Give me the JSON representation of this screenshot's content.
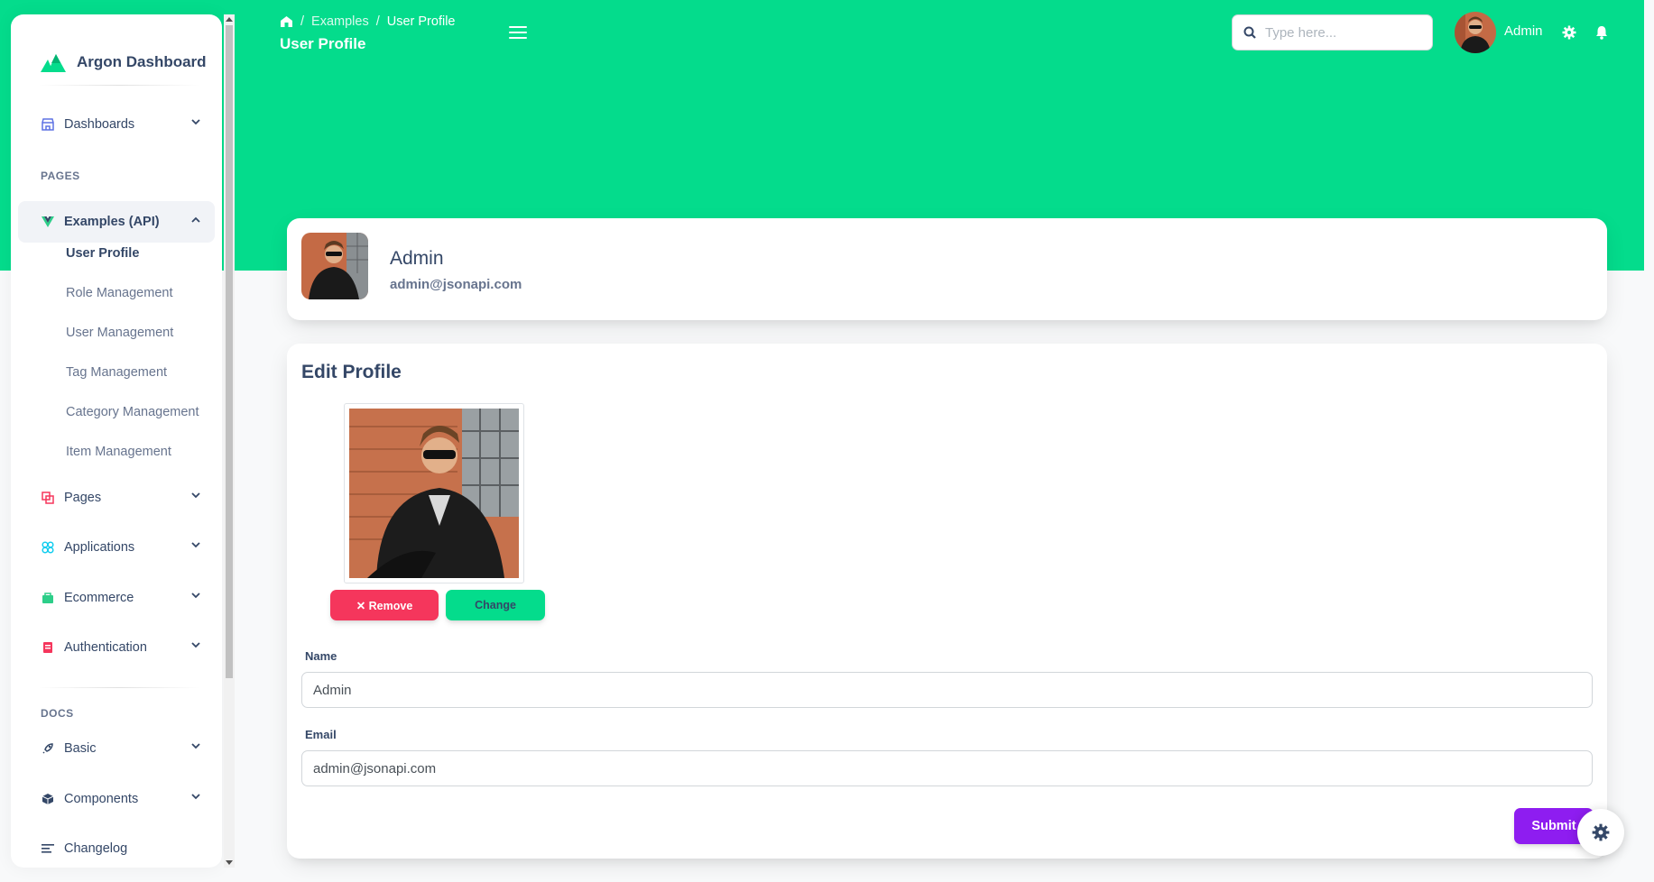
{
  "brand": {
    "name": "Argon Dashboard"
  },
  "sidebar": {
    "dashboards": "Dashboards",
    "pages_section": "PAGES",
    "examples": "Examples (API)",
    "sub_items": [
      "User Profile",
      "Role Management",
      "User Management",
      "Tag Management",
      "Category Management",
      "Item Management"
    ],
    "pages": "Pages",
    "applications": "Applications",
    "ecommerce": "Ecommerce",
    "authentication": "Authentication",
    "docs_section": "DOCS",
    "basic": "Basic",
    "components": "Components",
    "changelog": "Changelog"
  },
  "header": {
    "breadcrumb_examples": "Examples",
    "breadcrumb_current": "User Profile",
    "breadcrumb_sep": "/",
    "title": "User Profile",
    "search_placeholder": "Type here...",
    "user_name": "Admin"
  },
  "profile": {
    "name": "Admin",
    "email": "admin@jsonapi.com"
  },
  "edit": {
    "title": "Edit Profile",
    "remove_label": "✕ Remove",
    "change_label": "Change",
    "name_label": "Name",
    "name_value": "Admin",
    "email_label": "Email",
    "email_value": "admin@jsonapi.com",
    "submit_label": "Submit"
  },
  "colors": {
    "header_green": "#04dc8c",
    "remove_red": "#f5365c",
    "submit_purple": "#8e1df0",
    "text_dark": "#344767"
  },
  "icons": [
    "home-icon",
    "hamburger-icon",
    "search-icon",
    "gear-icon",
    "bell-icon",
    "shop-icon",
    "vue-icon",
    "pages-icon",
    "apps-icon",
    "ecommerce-icon",
    "auth-icon",
    "rocket-icon",
    "box-icon",
    "changelog-icon",
    "chevron-down-icon",
    "chevron-up-icon"
  ]
}
